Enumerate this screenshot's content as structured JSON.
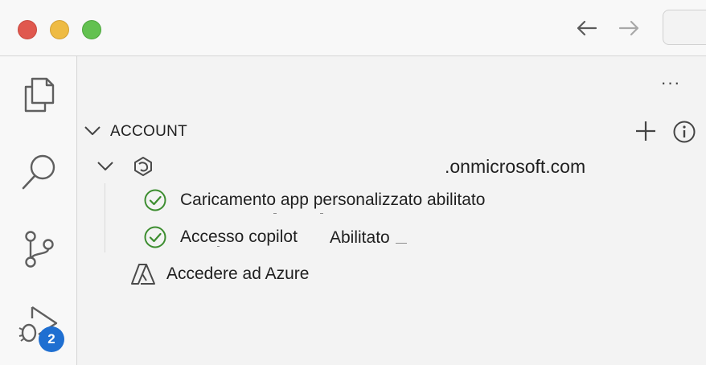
{
  "titlebar": {
    "icons": [
      "back-arrow-icon",
      "forward-arrow-icon"
    ]
  },
  "activity_bar": {
    "items": [
      {
        "icon": "explorer-files-icon"
      },
      {
        "icon": "search-icon"
      },
      {
        "icon": "source-control-icon"
      },
      {
        "icon": "run-debug-icon",
        "badge": "2"
      }
    ]
  },
  "panel": {
    "more_label": "···",
    "section": {
      "title": "ACCOUNT",
      "actions": [
        "add-icon",
        "info-icon"
      ]
    },
    "account": {
      "domain": ".onmicrosoft.com",
      "icon": "m365-logo-icon",
      "children": [
        {
          "label": "Caricamento app personalizzato abilitato",
          "icon": "check-circle-icon"
        },
        {
          "label": "Accesso copilot",
          "value": "Abilitato",
          "icon": "check-circle-icon"
        }
      ]
    },
    "azure": {
      "label": "Accedere ad Azure",
      "icon": "azure-logo-icon"
    }
  },
  "colors": {
    "accent": "#1f6fd1",
    "success": "#3c8d2f",
    "close": "#e0584e",
    "minimize": "#eebb43",
    "maximize": "#63c150"
  }
}
